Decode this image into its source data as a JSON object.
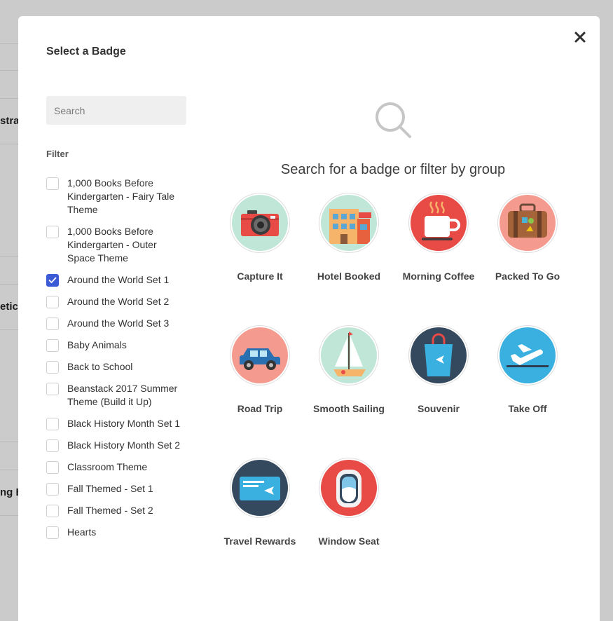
{
  "background": {
    "fragments": [
      "strati",
      "etic",
      "ng B"
    ]
  },
  "modal": {
    "title": "Select a Badge",
    "search": {
      "placeholder": "Search",
      "value": ""
    },
    "filter_label": "Filter",
    "filters": [
      {
        "label": "1,000 Books Before Kindergarten - Fairy Tale Theme",
        "checked": false
      },
      {
        "label": "1,000 Books Before Kindergarten - Outer Space Theme",
        "checked": false
      },
      {
        "label": "Around the World Set 1",
        "checked": true
      },
      {
        "label": "Around the World Set 2",
        "checked": false
      },
      {
        "label": "Around the World Set 3",
        "checked": false
      },
      {
        "label": "Baby Animals",
        "checked": false
      },
      {
        "label": "Back to School",
        "checked": false
      },
      {
        "label": "Beanstack 2017 Summer Theme (Build it Up)",
        "checked": false
      },
      {
        "label": "Black History Month Set 1",
        "checked": false
      },
      {
        "label": "Black History Month Set 2",
        "checked": false
      },
      {
        "label": "Classroom Theme",
        "checked": false
      },
      {
        "label": "Fall Themed - Set 1",
        "checked": false
      },
      {
        "label": "Fall Themed - Set 2",
        "checked": false
      },
      {
        "label": "Hearts",
        "checked": false
      }
    ],
    "prompt": "Search for a badge or filter by group",
    "badges": [
      {
        "label": "Capture It",
        "icon": "camera-icon"
      },
      {
        "label": "Hotel Booked",
        "icon": "hotel-icon"
      },
      {
        "label": "Morning Coffee",
        "icon": "coffee-cup-icon"
      },
      {
        "label": "Packed To Go",
        "icon": "suitcase-icon"
      },
      {
        "label": "Road Trip",
        "icon": "car-icon"
      },
      {
        "label": "Smooth Sailing",
        "icon": "sailboat-icon"
      },
      {
        "label": "Souvenir",
        "icon": "shopping-bag-icon"
      },
      {
        "label": "Take Off",
        "icon": "airplane-icon"
      },
      {
        "label": "Travel Rewards",
        "icon": "boarding-pass-icon"
      },
      {
        "label": "Window Seat",
        "icon": "airplane-window-icon"
      }
    ],
    "colors": {
      "accent": "#3b5bd6",
      "checkbox_border": "#cfcfcf"
    }
  }
}
